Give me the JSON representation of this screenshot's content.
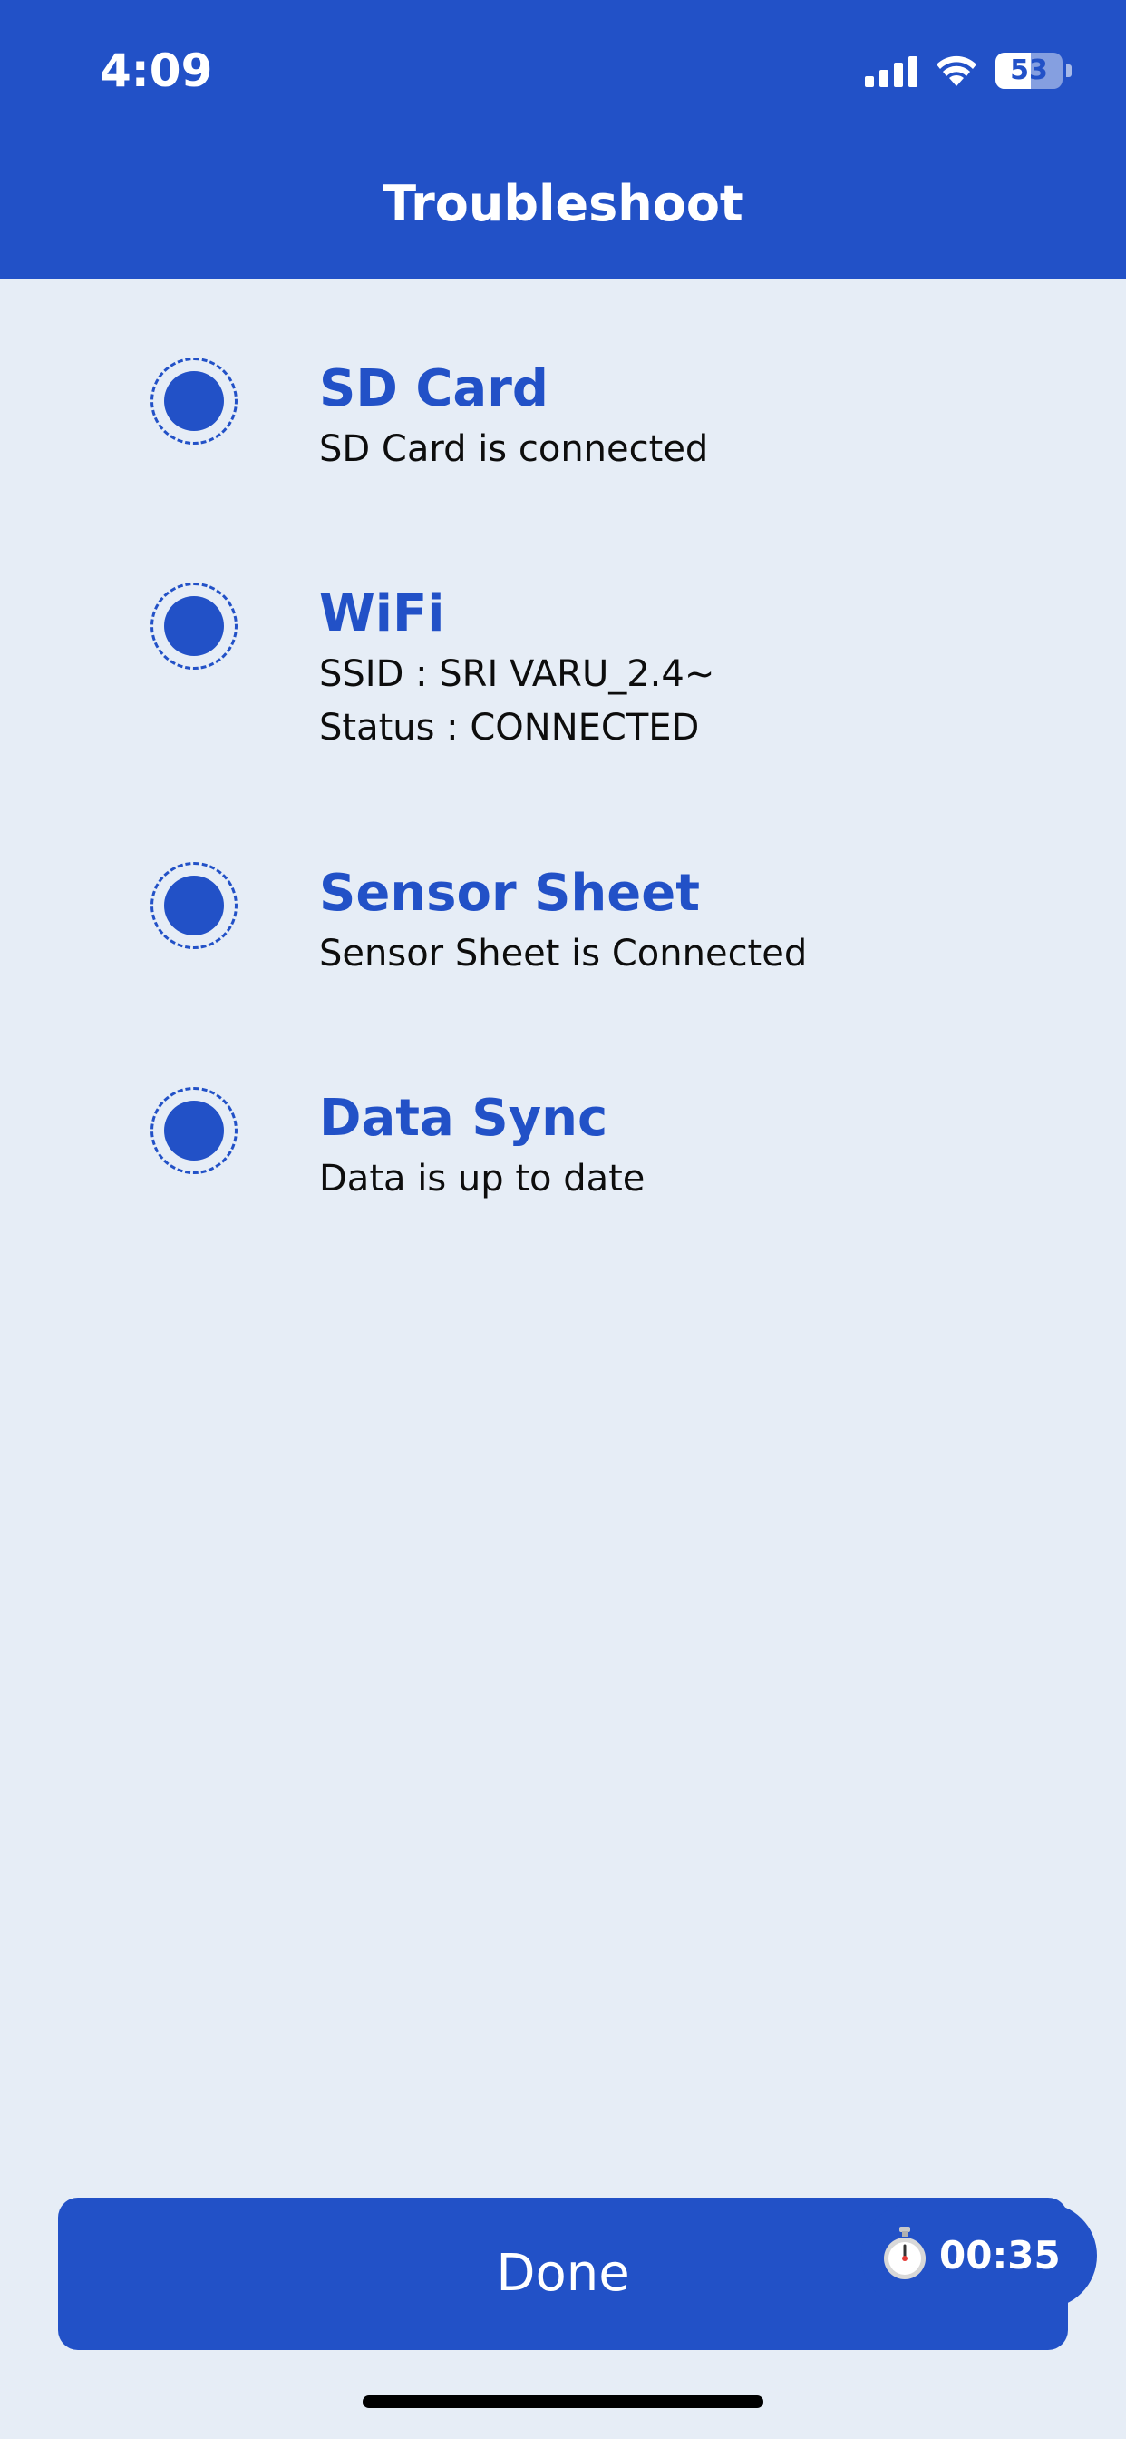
{
  "status_bar": {
    "time": "4:09",
    "battery": "53",
    "battery_level": 0.53
  },
  "header": {
    "title": "Troubleshoot"
  },
  "items": [
    {
      "title": "SD Card",
      "lines": [
        "SD Card is connected"
      ]
    },
    {
      "title": "WiFi",
      "lines": [
        "SSID : SRI VARU_2.4~",
        "Status : CONNECTED"
      ]
    },
    {
      "title": "Sensor Sheet",
      "lines": [
        "Sensor Sheet is Connected"
      ]
    },
    {
      "title": "Data Sync",
      "lines": [
        "Data is up to date"
      ]
    }
  ],
  "footer": {
    "done_label": "Done",
    "timer": "00:35"
  },
  "colors": {
    "accent": "#2251c7",
    "background": "#e6edf6",
    "text": "#0d0d0d"
  }
}
